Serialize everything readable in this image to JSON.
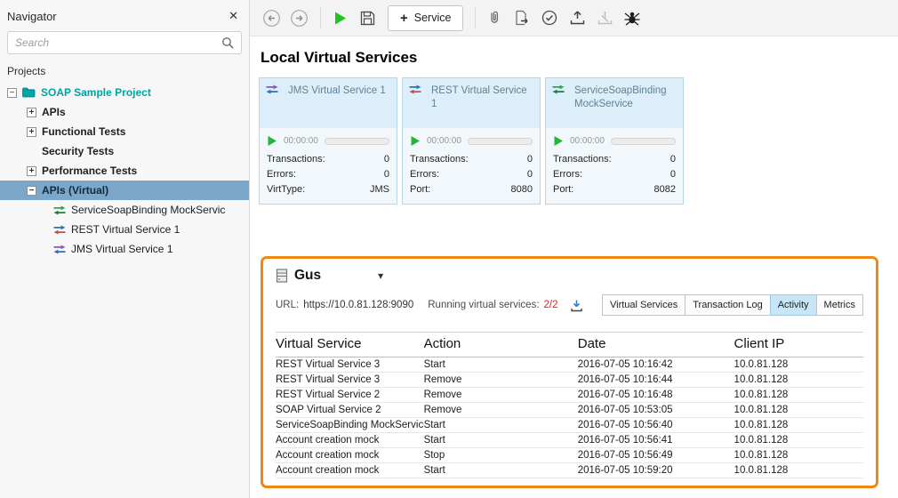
{
  "navigator": {
    "title": "Navigator",
    "search_placeholder": "Search",
    "projects_label": "Projects",
    "project_label": "SOAP Sample Project",
    "nodes": [
      "APIs",
      "Functional Tests",
      "Security Tests",
      "Performance Tests",
      "APIs (Virtual)"
    ],
    "virtual_services": [
      "ServiceSoapBinding MockServic",
      "REST Virtual Service 1",
      "JMS Virtual Service 1"
    ]
  },
  "toolbar": {
    "new_service_plus": "+",
    "new_service_label": "Service"
  },
  "icons": {
    "close": "✕",
    "caret_down": "▾",
    "collapse": "−",
    "expand": "+"
  },
  "main": {
    "heading": "Local Virtual Services",
    "cards": [
      {
        "title": "JMS Virtual Service 1",
        "time": "00:00:00",
        "rows": [
          {
            "label": "Transactions:",
            "value": "0"
          },
          {
            "label": "Errors:",
            "value": "0"
          },
          {
            "label": "VirtType:",
            "value": "JMS"
          }
        ]
      },
      {
        "title": "REST Virtual Service 1",
        "time": "00:00:00",
        "rows": [
          {
            "label": "Transactions:",
            "value": "0"
          },
          {
            "label": "Errors:",
            "value": "0"
          },
          {
            "label": "Port:",
            "value": "8080"
          }
        ]
      },
      {
        "title": "ServiceSoapBinding MockService",
        "time": "00:00:00",
        "rows": [
          {
            "label": "Transactions:",
            "value": "0"
          },
          {
            "label": "Errors:",
            "value": "0"
          },
          {
            "label": "Port:",
            "value": "8082"
          }
        ]
      }
    ]
  },
  "agent": {
    "name": "Gus",
    "url_label": "URL:",
    "url": "https://10.0.81.128:9090",
    "running_label": "Running virtual services:",
    "running_value": "2/2",
    "tabs": [
      {
        "label": "Virtual Services",
        "active": false
      },
      {
        "label": "Transaction Log",
        "active": false
      },
      {
        "label": "Activity",
        "active": true
      },
      {
        "label": "Metrics",
        "active": false
      }
    ],
    "table": {
      "headers": [
        "Virtual Service",
        "Action",
        "Date",
        "Client IP"
      ],
      "rows": [
        [
          "REST Virtual Service 3",
          "Start",
          "2016-07-05 10:16:42",
          "10.0.81.128"
        ],
        [
          "REST Virtual Service 3",
          "Remove",
          "2016-07-05 10:16:44",
          "10.0.81.128"
        ],
        [
          "REST Virtual Service 2",
          "Remove",
          "2016-07-05 10:16:48",
          "10.0.81.128"
        ],
        [
          "SOAP Virtual Service 2",
          "Remove",
          "2016-07-05 10:53:05",
          "10.0.81.128"
        ],
        [
          "ServiceSoapBinding MockService",
          "Start",
          "2016-07-05 10:56:40",
          "10.0.81.128"
        ],
        [
          "Account creation mock",
          "Start",
          "2016-07-05 10:56:41",
          "10.0.81.128"
        ],
        [
          "Account creation mock",
          "Stop",
          "2016-07-05 10:56:49",
          "10.0.81.128"
        ],
        [
          "Account creation mock",
          "Start",
          "2016-07-05 10:59:20",
          "10.0.81.128"
        ]
      ]
    }
  },
  "colors": {
    "accent_orange": "#ef8616",
    "selection_blue": "#7ba7ca",
    "project_teal": "#00a2a2",
    "running_count_red": "#e01f1f",
    "play_green": "#1dc422",
    "active_tab_blue": "#c7e7f9"
  }
}
